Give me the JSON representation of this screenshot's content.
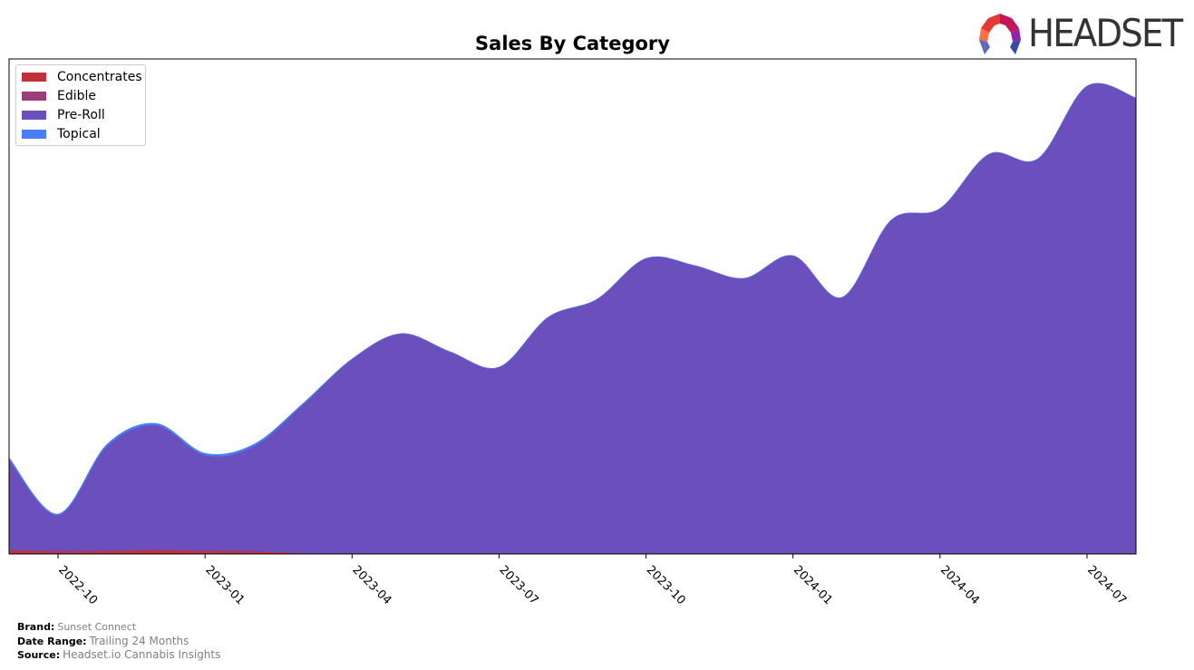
{
  "header": {
    "logo_text": "HEADSET"
  },
  "footer": {
    "brand_label": "Brand:",
    "brand_value": "Sunset Connect",
    "date_range_label": "Date Range:",
    "date_range_value": "Trailing 24 Months",
    "source_label": "Source:",
    "source_value": "Headset.io Cannabis Insights"
  },
  "chart_data": {
    "type": "area",
    "stacked": true,
    "title": "Sales By Category",
    "xlabel": "",
    "ylabel": "",
    "x": [
      "2022-09",
      "2022-10",
      "2022-11",
      "2022-12",
      "2023-01",
      "2023-02",
      "2023-03",
      "2023-04",
      "2023-05",
      "2023-06",
      "2023-07",
      "2023-08",
      "2023-09",
      "2023-10",
      "2023-11",
      "2023-12",
      "2024-01",
      "2024-02",
      "2024-03",
      "2024-04",
      "2024-05",
      "2024-06",
      "2024-07",
      "2024-08"
    ],
    "x_tick_labels": [
      "2022-10",
      "2023-01",
      "2023-04",
      "2023-07",
      "2023-10",
      "2024-01",
      "2024-04",
      "2024-07"
    ],
    "y_tick_labels": [],
    "ylim": [
      0,
      546
    ],
    "grid": false,
    "legend_position": "top-left",
    "series": [
      {
        "name": "Concentrates",
        "color": "#c0313a",
        "values": [
          4,
          3,
          3,
          4,
          3,
          3,
          1,
          0,
          0,
          0,
          0,
          0,
          0,
          0,
          0,
          0,
          0,
          0,
          0,
          0,
          0,
          0,
          0,
          0
        ]
      },
      {
        "name": "Edible",
        "color": "#9b3f7a",
        "values": [
          1,
          0,
          1,
          1,
          1,
          0,
          0,
          0,
          0,
          0,
          0,
          0,
          0,
          0,
          0,
          0,
          0,
          0,
          0,
          0,
          0,
          0,
          0,
          0
        ]
      },
      {
        "name": "Pre-Roll",
        "color": "#6a4fbd",
        "values": [
          99,
          40,
          115,
          137,
          105,
          116,
          164,
          215,
          243,
          223,
          206,
          261,
          281,
          326,
          318,
          304,
          329,
          283,
          368,
          381,
          441,
          436,
          516,
          503
        ]
      },
      {
        "name": "Topical",
        "color": "#4a7cf7",
        "values": [
          2,
          1,
          2,
          2,
          2,
          2,
          1,
          0,
          0,
          0,
          0,
          0,
          0,
          0,
          0,
          0,
          0,
          0,
          0,
          0,
          0,
          0,
          0,
          0
        ]
      }
    ]
  }
}
